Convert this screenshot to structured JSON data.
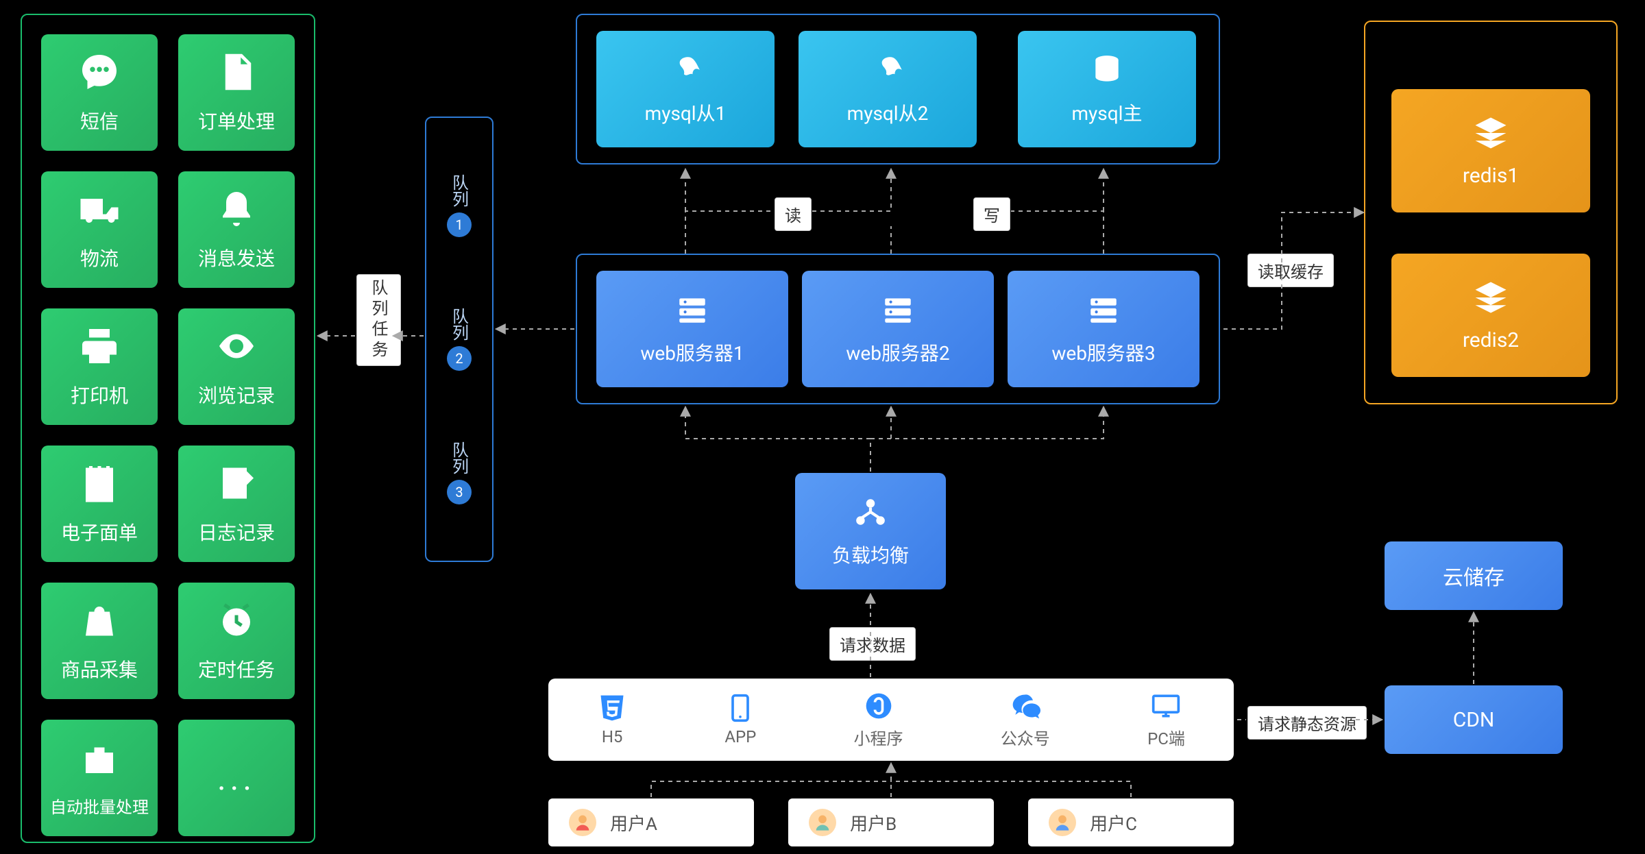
{
  "green": {
    "items": [
      {
        "label": "短信",
        "icon": "chat"
      },
      {
        "label": "订单处理",
        "icon": "file"
      },
      {
        "label": "物流",
        "icon": "truck"
      },
      {
        "label": "消息发送",
        "icon": "bell"
      },
      {
        "label": "打印机",
        "icon": "printer"
      },
      {
        "label": "浏览记录",
        "icon": "eye"
      },
      {
        "label": "电子面单",
        "icon": "note"
      },
      {
        "label": "日志记录",
        "icon": "log"
      },
      {
        "label": "商品采集",
        "icon": "bag"
      },
      {
        "label": "定时任务",
        "icon": "clock"
      },
      {
        "label": "自动批量处理",
        "icon": "kit"
      },
      {
        "label": "...",
        "icon": "dots"
      }
    ]
  },
  "queue": {
    "task_label": "队列任务",
    "items": [
      {
        "label": "队列",
        "num": "1"
      },
      {
        "label": "队列",
        "num": "2"
      },
      {
        "label": "队列",
        "num": "3"
      }
    ]
  },
  "db": {
    "items": [
      {
        "label": "mysql从1"
      },
      {
        "label": "mysql从2"
      },
      {
        "label": "mysql主"
      }
    ],
    "read_label": "读",
    "write_label": "写"
  },
  "web": {
    "items": [
      {
        "label": "web服务器1"
      },
      {
        "label": "web服务器2"
      },
      {
        "label": "web服务器3"
      }
    ]
  },
  "lb": {
    "label": "负载均衡"
  },
  "req_data_label": "请求数据",
  "clients": {
    "items": [
      {
        "label": "H5"
      },
      {
        "label": "APP"
      },
      {
        "label": "小程序"
      },
      {
        "label": "公众号"
      },
      {
        "label": "PC端"
      }
    ]
  },
  "users": {
    "items": [
      {
        "label": "用户A"
      },
      {
        "label": "用户B"
      },
      {
        "label": "用户C"
      }
    ]
  },
  "redis": {
    "items": [
      {
        "label": "redis1"
      },
      {
        "label": "redis2"
      }
    ],
    "cache_label": "读取缓存"
  },
  "cdn": {
    "label": "CDN"
  },
  "storage": {
    "label": "云储存"
  },
  "static_label": "请求静态资源"
}
